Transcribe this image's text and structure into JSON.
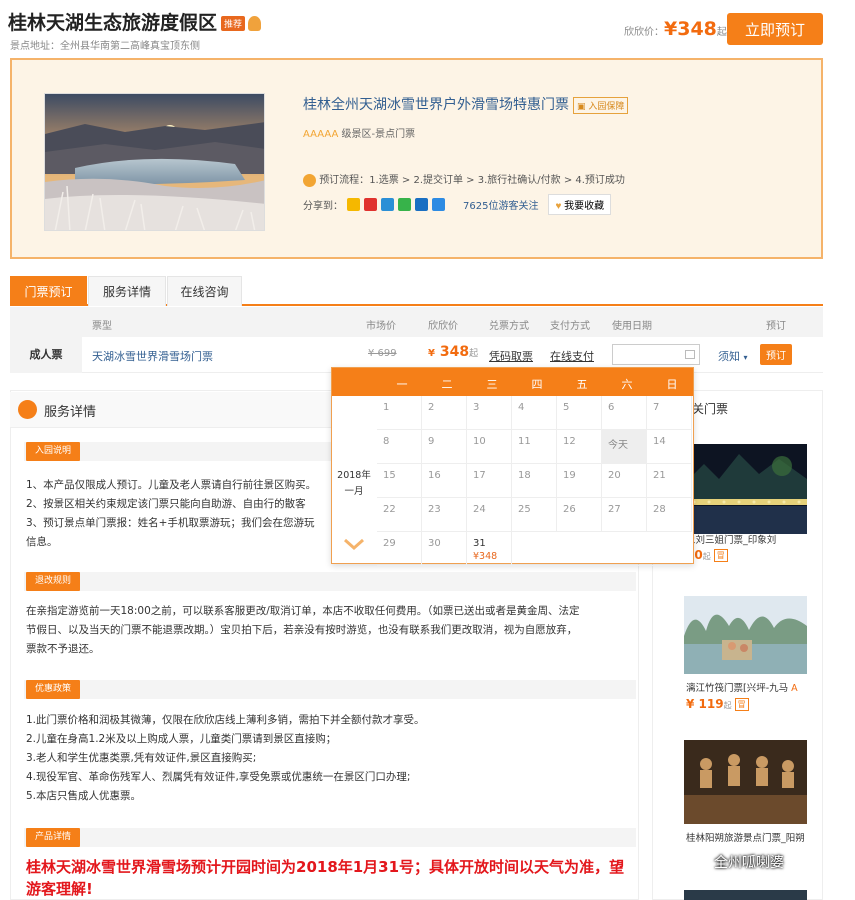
{
  "header": {
    "title": "桂林天湖生态旅游度假区",
    "recommend_tag": "推荐",
    "address": "景点地址：全州县华南第二高峰真宝顶东侧",
    "price_label": "欣欣价：",
    "price_currency": "¥",
    "price": "348",
    "price_suffix": "起",
    "book_now": "立即预订"
  },
  "product": {
    "name": "桂林全州天湖冰雪世界户外滑雪场特惠门票",
    "guarantee": "入园保障",
    "stars": "AAAAA",
    "level_text": " 级景区-景点门票",
    "process_label": "预订流程：",
    "process_steps": "1.选票 > 2.提交订单 > 3.旅行社确认/付款 > 4.预订成功",
    "share_label": "分享到：",
    "followers": "7625位游客关注",
    "favorite": "我要收藏"
  },
  "tabs": [
    "门票预订",
    "服务详情",
    "在线咨询"
  ],
  "ticket_table": {
    "headers": [
      "票型",
      "市场价",
      "欣欣价",
      "兑票方式",
      "支付方式",
      "使用日期",
      "预订"
    ],
    "row": {
      "category": "成人票",
      "name": "天湖冰雪世界滑雪场门票",
      "market_price": "¥ 699",
      "price_currency": "¥",
      "price": "348",
      "price_suffix": "起",
      "redeem": "凭码取票",
      "pay": "在线支付",
      "notice": "须知",
      "book": "预订"
    }
  },
  "calendar": {
    "weekdays": [
      "一",
      "二",
      "三",
      "四",
      "五",
      "六",
      "日"
    ],
    "year": "2018年",
    "month": "一月",
    "days": [
      [
        "1",
        "2",
        "3",
        "4",
        "5",
        "6",
        "7"
      ],
      [
        "8",
        "9",
        "10",
        "11",
        "12",
        "今天",
        "14"
      ],
      [
        "15",
        "16",
        "17",
        "18",
        "19",
        "20",
        "21"
      ],
      [
        "22",
        "23",
        "24",
        "25",
        "26",
        "27",
        "28"
      ],
      [
        "29",
        "30",
        "31",
        "",
        "",
        "",
        ""
      ]
    ],
    "price_day_31": "¥348"
  },
  "service": {
    "title": "服务详情",
    "sections": [
      {
        "badge": "入园说明",
        "lines": [
          "1、本产品仅限成人预订。儿童及老人票请自行前往景区购买。",
          "2、按景区相关约束规定该门票只能向自助游、自由行的散客",
          "3、预订景点单门票报：姓名+手机取票游玩；我们会在您游玩",
          "信息。"
        ]
      },
      {
        "badge": "退改规则",
        "lines": [
          "在亲指定游览前一天18:00之前，可以联系客服更改/取消订单，本店不收取任何费用。（如票已送出或者是黄金周、法定",
          "节假日、以及当天的门票不能退票改期。）宝贝拍下后，若亲没有按时游览，也没有联系我们更改取消，视为自愿放弃，",
          "票款不予退还。"
        ]
      },
      {
        "badge": "优惠政策",
        "lines": [
          "1.此门票价格和润极其微薄，仅限在欣欣店线上薄利多销，需拍下并全额付款才享受。",
          "2.儿童在身高1.2米及以上购成人票，儿童类门票请到景区直接购；",
          "3.老人和学生优惠类票,凭有效证件,景区直接购买;",
          "4.现役军官、革命伤残军人、烈属凭有效证件,享受免票或优惠统一在景区门口办理;",
          "5.本店只售成人优惠票。"
        ]
      },
      {
        "badge": "产品详情",
        "lines": []
      }
    ],
    "detail_red": "桂林天湖冰雪世界滑雪场预计开园时间为2018年1月31号；具体开放时间以天气为准，望游客理解!"
  },
  "sidebar": {
    "title": "关门票",
    "items": [
      {
        "name": "象刘三姐门票_印象刘",
        "price": "20",
        "price_prefix": "",
        "suffix": "起",
        "badge": "冒"
      },
      {
        "name": "漓江竹筏门票[兴坪-九马",
        "price": "119",
        "price_prefix": "¥ ",
        "suffix": "起",
        "badge": "冒",
        "extra": "A"
      },
      {
        "name": "桂林阳朔旅游景点门票_阳朔",
        "price": "",
        "price_prefix": "",
        "suffix": "",
        "badge": ""
      }
    ]
  },
  "watermark": "全州呱喇婆",
  "colors": {
    "accent": "#f57f18",
    "price": "#f26b0f",
    "alert": "#e3171c",
    "link": "#335f91"
  }
}
